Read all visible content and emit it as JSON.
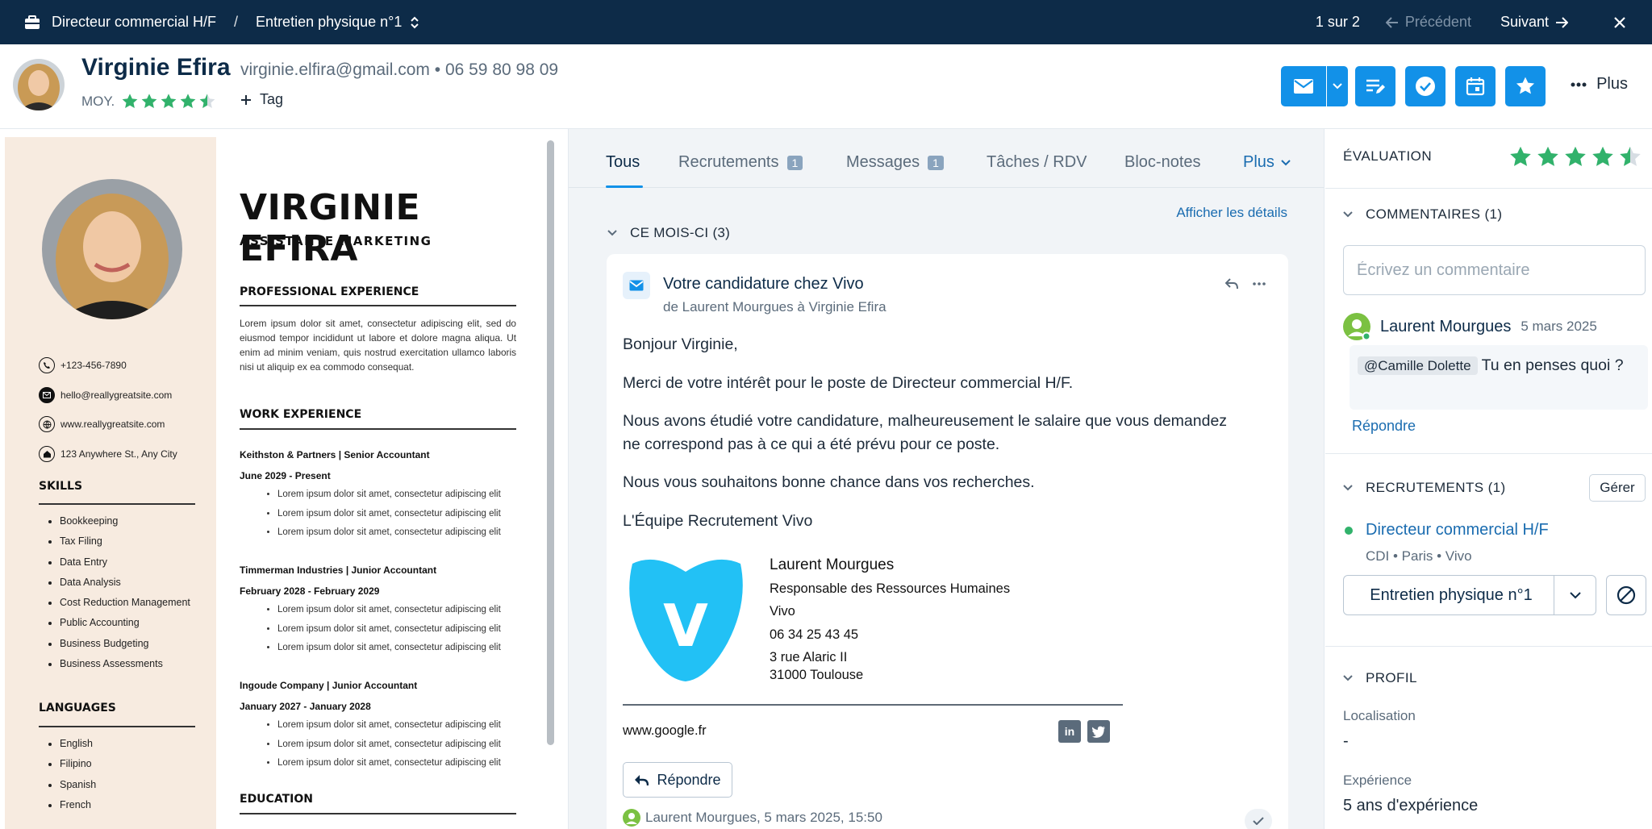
{
  "topbar": {
    "job": "Directeur commercial H/F",
    "separator": "/",
    "stage": "Entretien physique n°1",
    "pager": "1 sur 2",
    "prev": "Précédent",
    "next": "Suivant"
  },
  "candidate": {
    "name": "Virginie Efira",
    "email": "virginie.elfira@gmail.com",
    "bullet": "•",
    "phone": "06 59 80 98 09",
    "avg_label": "MOY.",
    "rating": 4.5,
    "tag_label": "Tag"
  },
  "header_actions": {
    "more_label": "Plus"
  },
  "resume": {
    "name": "VIRGINIE EFIRA",
    "title": "ASSISTANTE MARKETING",
    "contacts": [
      {
        "icon": "phone-icon",
        "text": "+123-456-7890"
      },
      {
        "icon": "mail-icon",
        "text": "hello@reallygreatsite.com"
      },
      {
        "icon": "globe-icon",
        "text": "www.reallygreatsite.com"
      },
      {
        "icon": "home-icon",
        "text": "123 Anywhere St., Any City"
      }
    ],
    "skills_heading": "SKILLS",
    "skills": [
      "Bookkeeping",
      "Tax Filing",
      "Data Entry",
      "Data Analysis",
      "Cost Reduction Management",
      "Public Accounting",
      "Business Budgeting",
      "Business Assessments"
    ],
    "languages_heading": "LANGUAGES",
    "languages": [
      "English",
      "Filipino",
      "Spanish",
      "French"
    ],
    "pro_heading": "PROFESSIONAL EXPERIENCE",
    "pro_text": "Lorem ipsum dolor sit amet, consectetur adipiscing elit, sed do eiusmod tempor incididunt ut labore et dolore magna aliqua. Ut enim ad minim veniam, quis nostrud exercitation ullamco laboris nisi ut aliquip ex ea commodo consequat.",
    "work_heading": "WORK EXPERIENCE",
    "jobs": [
      {
        "title": "Keithston & Partners | Senior Accountant",
        "dates": "June 2029 - Present",
        "bullets": [
          "Lorem ipsum dolor sit amet, consectetur adipiscing elit",
          "Lorem ipsum dolor sit amet, consectetur adipiscing elit",
          "Lorem ipsum dolor sit amet, consectetur adipiscing elit"
        ]
      },
      {
        "title": "Timmerman Industries | Junior Accountant",
        "dates": "February 2028 - February 2029",
        "bullets": [
          "Lorem ipsum dolor sit amet, consectetur adipiscing elit",
          "Lorem ipsum dolor sit amet, consectetur adipiscing elit",
          "Lorem ipsum dolor sit amet, consectetur adipiscing elit"
        ]
      },
      {
        "title": "Ingoude Company | Junior Accountant",
        "dates": "January 2027 - January 2028",
        "bullets": [
          "Lorem ipsum dolor sit amet, consectetur adipiscing elit",
          "Lorem ipsum dolor sit amet, consectetur adipiscing elit",
          "Lorem ipsum dolor sit amet, consectetur adipiscing elit"
        ]
      }
    ],
    "education_heading": "EDUCATION"
  },
  "tabs": [
    {
      "label": "Tous",
      "badge": ""
    },
    {
      "label": "Recrutements",
      "badge": "1"
    },
    {
      "label": "Messages",
      "badge": "1"
    },
    {
      "label": "Tâches / RDV",
      "badge": ""
    },
    {
      "label": "Bloc-notes",
      "badge": ""
    },
    {
      "label": "Plus",
      "badge": ""
    }
  ],
  "feed": {
    "details_link": "Afficher les détails",
    "section_title": "CE MOIS-CI (3)"
  },
  "email": {
    "subject": "Votre candidature chez Vivo",
    "from": "de Laurent Mourgues à Virginie Efira",
    "paragraphs": [
      "Bonjour Virginie,",
      "Merci de votre intérêt pour le poste de Directeur commercial H/F.",
      "Nous avons étudié votre candidature, malheureusement le salaire que vous demandez ne correspond pas à ce qui a été prévu pour ce poste.",
      "Nous vous souhaitons bonne chance dans vos recherches.",
      "L'Équipe Recrutement Vivo"
    ],
    "signature": {
      "logo_letter": "V",
      "name": "Laurent Mourgues",
      "role": "Responsable des Ressources Humaines",
      "company": "Vivo",
      "phone": "06 34 25 43 45",
      "address1": "3 rue Alaric II",
      "address2": "31000 Toulouse",
      "website": "www.google.fr",
      "linkedin": "in",
      "twitter_icon": "twitter-icon"
    },
    "reply_label": "Répondre",
    "footer": "Laurent Mourgues, 5 mars 2025, 15:50"
  },
  "sidebar": {
    "evaluation_label": "ÉVALUATION",
    "evaluation_rating": 4.5,
    "comments_title": "COMMENTAIRES (1)",
    "comment_placeholder": "Écrivez un commentaire",
    "comment": {
      "author": "Laurent Mourgues",
      "date": "5 mars 2025",
      "mention": "@Camille Dolette",
      "text": "Tu en penses quoi ?",
      "reply_label": "Répondre"
    },
    "recruitments_title": "RECRUTEMENTS (1)",
    "manage_label": "Gérer",
    "job": {
      "title": "Directeur commercial H/F",
      "meta": "CDI  • Paris • Vivo",
      "stage": "Entretien physique n°1"
    },
    "profile_title": "PROFIL",
    "location_label": "Localisation",
    "location_value": "-",
    "experience_label": "Expérience",
    "experience_value": "5 ans d'expérience"
  },
  "colors": {
    "topbar": "#0d2b48",
    "accent": "#1291e8",
    "star": "#31b26b",
    "link": "#1a6cb0",
    "cv_sidebar": "#f7ebe0",
    "logo": "#22c1f5"
  }
}
